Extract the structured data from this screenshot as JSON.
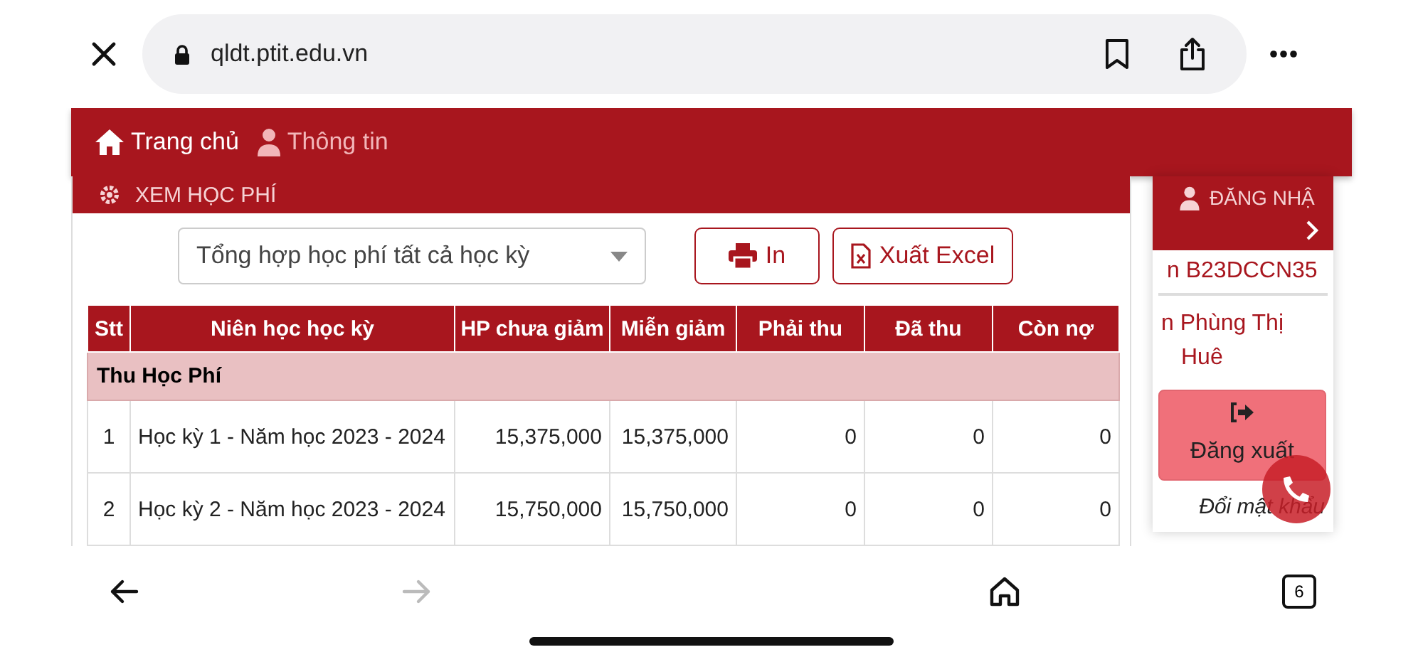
{
  "browser": {
    "url": "qldt.ptit.edu.vn"
  },
  "nav": [
    {
      "kind": "home",
      "label": "Trang chủ",
      "selected": true
    },
    {
      "kind": "user",
      "label": "Thông tin",
      "selected": false
    }
  ],
  "panel": {
    "title": "XEM HỌC PHÍ",
    "select": {
      "value": "Tổng hợp học phí tất cả học kỳ"
    },
    "buttons": [
      {
        "kind": "print",
        "label": "In"
      },
      {
        "kind": "excel",
        "label": "Xuất Excel"
      }
    ]
  },
  "table": {
    "columns": [
      "Stt",
      "Niên học học kỳ",
      "HP chưa giảm",
      "Miễn giảm",
      "Phải thu",
      "Đã thu",
      "Còn nợ"
    ],
    "rows": [
      {
        "kind": "group",
        "label": "Thu Học Phí"
      },
      {
        "kind": "item",
        "cells": [
          "1",
          "Học kỳ 1 - Năm học 2023 - 2024",
          "15,375,000",
          "15,375,000",
          "0",
          "0",
          "0"
        ]
      },
      {
        "kind": "item",
        "cells": [
          "2",
          "Học kỳ 2 - Năm học 2023 - 2024",
          "15,750,000",
          "15,750,000",
          "0",
          "0",
          "0"
        ]
      }
    ]
  },
  "sidebar": {
    "title": "ĐĂNG NHẬ",
    "student_id": "n B23DCCN35",
    "name": "n Phùng Thị Huê",
    "logout": "Đăng xuất",
    "change_password": "Đổi mật khẩu"
  },
  "bottom_bar": {
    "forward_disabled": true,
    "tab_count": "6"
  }
}
